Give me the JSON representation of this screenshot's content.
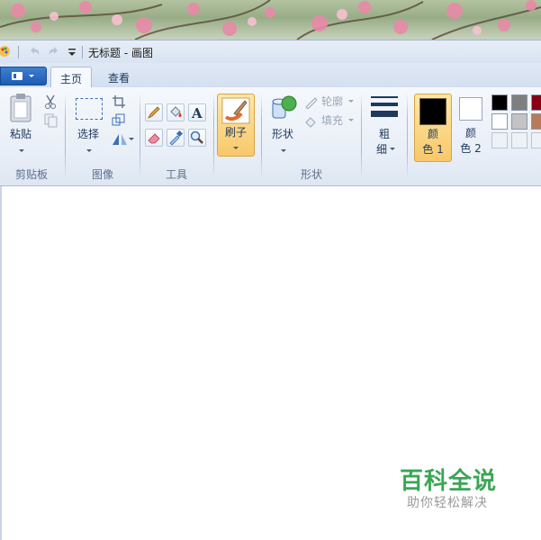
{
  "window": {
    "title": "无标题 - 画图"
  },
  "tabs": [
    {
      "label": "主页",
      "active": true
    },
    {
      "label": "查看",
      "active": false
    }
  ],
  "groups": {
    "clipboard": {
      "label": "剪贴板",
      "paste_label": "粘贴"
    },
    "image": {
      "label": "图像",
      "select_label": "选择"
    },
    "tools": {
      "label": "工具"
    },
    "brushes": {
      "label": "刷子"
    },
    "shapes": {
      "label": "形状",
      "shapes_label": "形状",
      "outline_label": "轮廓",
      "fill_label": "填充"
    },
    "size": {
      "label_line1": "粗",
      "label_line2": "细"
    },
    "colors": {
      "color1_line1": "颜",
      "color1_line2": "色 1",
      "color2_line1": "颜",
      "color2_line2": "色 2",
      "color1_value": "#000000",
      "color2_value": "#ffffff",
      "palette": [
        "#000000",
        "#7f7f7f",
        "#880015",
        "#ffffff",
        "#c3c3c3",
        "#b97a57"
      ]
    }
  },
  "watermark": {
    "title": "百科全说",
    "subtitle": "助你轻松解决"
  },
  "accent": "#3aa655"
}
